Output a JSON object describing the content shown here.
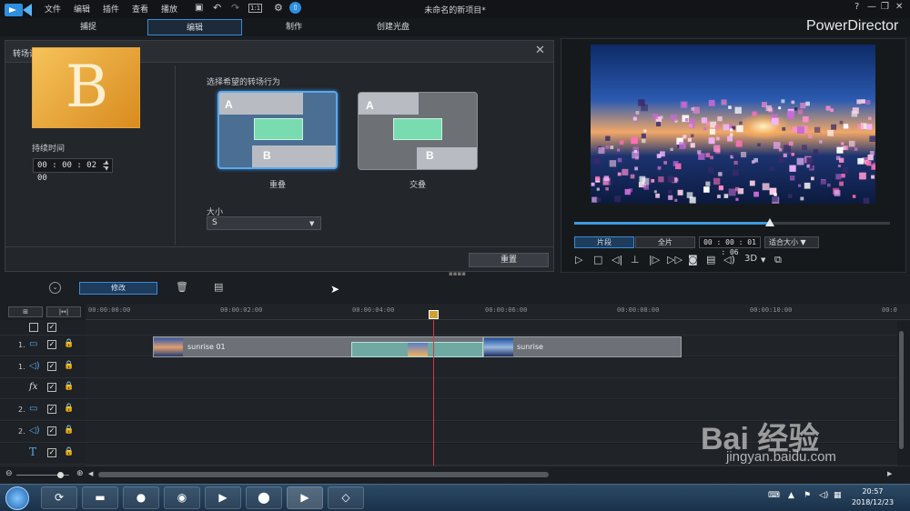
{
  "menu": [
    "文件",
    "编辑",
    "插件",
    "查看",
    "播放"
  ],
  "window": {
    "title": "未命名的新项目*",
    "zoom_icon_label": "1:1"
  },
  "modes": [
    "捕捉",
    "编辑",
    "制作",
    "创建光盘"
  ],
  "active_mode": "编辑",
  "brand": "PowerDirector",
  "transition_panel": {
    "title": "转场设置",
    "thumb_letter": "B",
    "duration_label": "持续时间",
    "duration_value": "00 : 00 : 02 : 00",
    "behavior_label": "选择希望的转场行为",
    "behaviors": [
      {
        "name": "重叠",
        "a": "A",
        "b": "B",
        "selected": true
      },
      {
        "name": "交叠",
        "a": "A",
        "b": "B",
        "selected": false
      }
    ],
    "size_label": "大小",
    "size_value": "S",
    "reset_label": "重置"
  },
  "preview": {
    "progress": 0.62,
    "clip_tab": "片段",
    "movie_tab": "全片",
    "timecode": "00 : 00 : 01 : 06",
    "fit_label": "适合大小",
    "mode_3d": "3D"
  },
  "toolbar": {
    "modify_label": "修改"
  },
  "timeline": {
    "ticks": [
      "00:00:00:00",
      "00:00:02:00",
      "00:00:04:00",
      "00:00:06:00",
      "00:00:08:00",
      "00:00:10:00",
      "00:0"
    ],
    "tracks": [
      {
        "num": "",
        "type": "all"
      },
      {
        "num": "1.",
        "type": "video"
      },
      {
        "num": "1.",
        "type": "audio"
      },
      {
        "num": "",
        "type": "fx"
      },
      {
        "num": "2.",
        "type": "video"
      },
      {
        "num": "2.",
        "type": "audio"
      },
      {
        "num": "",
        "type": "title"
      }
    ],
    "clips": [
      {
        "label": "sunrise 01"
      },
      {
        "label": "sunrise"
      }
    ]
  },
  "taskbar": {
    "time": "20:57",
    "date": "2018/12/23"
  },
  "watermark": {
    "text": "Bai 经验",
    "url": "jingyan.baidu.com"
  }
}
